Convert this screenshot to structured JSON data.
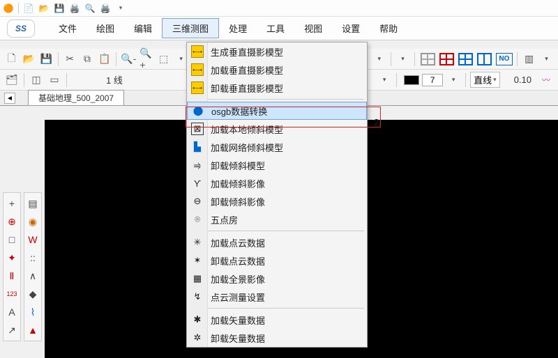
{
  "titlebar_icons": [
    "new",
    "open",
    "save",
    "print-all",
    "preview",
    "print"
  ],
  "menubar": {
    "logo": "SS",
    "items": [
      "文件",
      "绘图",
      "编辑",
      "三维测图",
      "处理",
      "工具",
      "视图",
      "设置",
      "帮助"
    ],
    "active_index": 3
  },
  "toolbar1": {
    "left_icons": [
      "new",
      "open",
      "save",
      "cut",
      "copy",
      "paste",
      "zoom-out",
      "zoom-in",
      "zoom-window",
      "fit"
    ],
    "right": {
      "grid_icons": [
        "layout1",
        "layout2",
        "layout3",
        "layout4",
        "layout5"
      ],
      "no_label": "NO",
      "wave_icon": "toggle"
    }
  },
  "toolbar2": {
    "left_icons": [
      "layers-panel",
      "entities",
      "popup"
    ],
    "line_label": "1 线",
    "right": {
      "swatch": "#000000",
      "size_value": "7",
      "linestyle_label": "直线",
      "width_value": "0.10"
    }
  },
  "tabs": {
    "scroll_icon": "◄",
    "active_label": "基础地理_500_2007"
  },
  "red_annotation_label": "2",
  "dropdown": {
    "groups": [
      {
        "items": [
          {
            "icon": "ybus",
            "label": "生成垂直摄影模型"
          },
          {
            "icon": "ybus",
            "label": "加载垂直摄影模型"
          },
          {
            "icon": "ybus",
            "label": "卸载垂直摄影模型"
          }
        ]
      },
      {
        "items": [
          {
            "icon": "bluec",
            "glyph": "⬤",
            "label": "osgb数据转换",
            "selected": true
          },
          {
            "icon": "box",
            "glyph": "⊠",
            "label": "加载本地倾斜模型"
          },
          {
            "icon": "bluec",
            "glyph": "▙",
            "label": "加载网络倾斜模型"
          },
          {
            "icon": "",
            "glyph": "⥤",
            "label": "卸载倾斜模型"
          },
          {
            "icon": "",
            "glyph": "ϒ",
            "label": "加载倾斜影像"
          },
          {
            "icon": "",
            "glyph": "⊖",
            "label": "卸载倾斜影像"
          },
          {
            "icon": "",
            "glyph": "⌾",
            "label": "五点房"
          }
        ]
      },
      {
        "items": [
          {
            "icon": "",
            "glyph": "✳",
            "label": "加载点云数据"
          },
          {
            "icon": "",
            "glyph": "✶",
            "label": "卸载点云数据"
          },
          {
            "icon": "",
            "glyph": "▦",
            "label": "加载全景影像"
          },
          {
            "icon": "",
            "glyph": "↯",
            "label": "点云测量设置"
          }
        ]
      },
      {
        "items": [
          {
            "icon": "",
            "glyph": "✱",
            "label": "加载矢量数据"
          },
          {
            "icon": "",
            "glyph": "✲",
            "label": "卸载矢量数据"
          }
        ]
      }
    ]
  },
  "palette_a": [
    {
      "g": "+",
      "c": ""
    },
    {
      "g": "⊕",
      "c": "red"
    },
    {
      "g": "□",
      "c": ""
    },
    {
      "g": "✦",
      "c": "red"
    },
    {
      "g": "Ⅱ",
      "c": "red"
    },
    {
      "g": "123",
      "c": "red"
    },
    {
      "g": "A",
      "c": ""
    },
    {
      "g": "↗",
      "c": ""
    }
  ],
  "palette_b": [
    {
      "g": "▤",
      "c": ""
    },
    {
      "g": "◉",
      "c": "ora"
    },
    {
      "g": "W",
      "c": "red"
    },
    {
      "g": "::",
      "c": ""
    },
    {
      "g": "∧",
      "c": ""
    },
    {
      "g": "◆",
      "c": ""
    },
    {
      "g": "⌇",
      "c": "blue"
    },
    {
      "g": "▲",
      "c": "red"
    }
  ]
}
